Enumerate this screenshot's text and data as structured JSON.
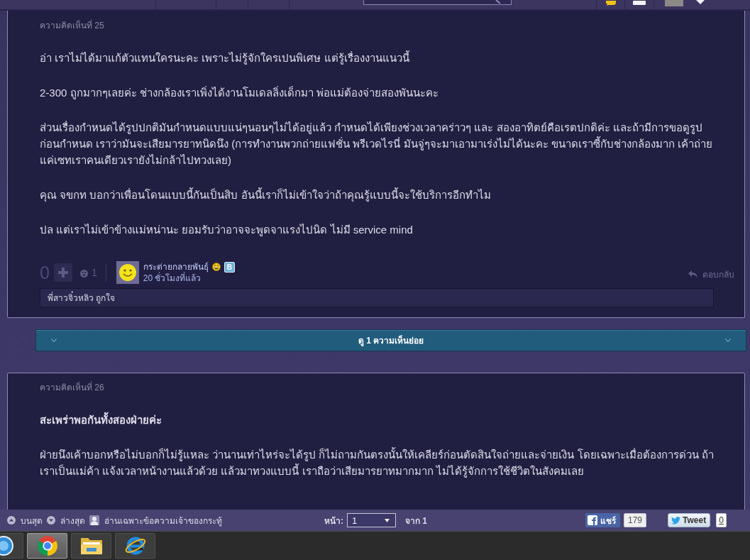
{
  "comments": [
    {
      "number_label": "ความคิดเห็นที่ 25",
      "paragraphs": [
        {
          "text": "อ่า เราไม่ได้มาแก้ตัวแทนใครนะคะ เพราะไม่รู้จักใครเปนพิเศษ แต่รู้เรื่องงานแนวนี้",
          "bold": false
        },
        {
          "text": "2-300 ถูกมากๆเลยค่ะ ช่างกล้องเราเพิ่งได้งานโมเดลลิ่งเด็กมา พ่อแม่ต้องจ่ายสองพันนะคะ",
          "bold": false
        },
        {
          "text": "ส่วนเรื่องกำหนดได้รูปปกติมันกำหนดแบบแน่ๆนอนๆไม่ได้อยู่แล้ว กำหนดได้เพียงช่วงเวลาคร่าวๆ และ สองอาทิตย์คือเรตปกติค่ะ และถ้ามีการขอดูรูปก่อนกำหนด เราว่ามันจะเสียมารยาทนิดนึง (การทำงานพวกถ่ายแฟชั่น พรีเวดไรนี่ มันจู่ๆจะมาเอามาเร่งไม่ได้นะคะ ขนาดเราซี้กับช่างกล้องมาก เค้าถ่ายแค่เซทเราคนเดียวเรายังไม่กล้าไปทวงเลย)",
          "bold": false
        },
        {
          "text": "คุณ จขกท บอกว่าเพื่อนโดนแบบนี้กันเป็นสิบ อันนี้เราก็ไม่เข้าใจว่าถ้าคุณรู้แบบนี้จะใช้บริการอีกทำไม",
          "bold": false
        },
        {
          "text": "ปล แต่เราไม่เข้าข้างแม่หน่านะ ยอมรับว่าอาจจะพูดจาแรงไปนิด ไม่มี service mind",
          "bold": false
        }
      ],
      "votes": "0",
      "emotion_count": "1",
      "author": {
        "name": "กระต่ายกลายพันธุ์",
        "badge": "B",
        "time": "20 ชั่วโมงที่แล้ว"
      },
      "reply_label": "ตอบกลับ",
      "reactions_note": "พี่สาวจิ๋วหลิว ถูกใจ",
      "replies_button": "ดู 1 ความเห็นย่อย"
    },
    {
      "number_label": "ความคิดเห็นที่ 26",
      "paragraphs": [
        {
          "text": "สะเพร่าพอกันทั้งสองฝ่ายค่ะ",
          "bold": true
        },
        {
          "text": "ฝ่ายนึงเค้าบอกหรือไม่บอกก็ไม่รู้แหละ ว่านานเท่าไหร่จะได้รูป ก็ไม่ถามกันตรงนั้นให้เคลียร์ก่อนตัดสินใจถ่ายและจ่ายเงิน โดยเฉพาะเมื่อต้องการด่วน ถ้าเราเป็นแม่ค้า แจ้งเวลาหน้างานแล้วด้วย แล้วมาทวงแบบนี้ เราถือว่าเสียมารยาทมากมาก ไม่ได้รู้จักการใช้ชีวิตในสังคมเลย",
          "bold": false
        }
      ]
    }
  ],
  "bottom_bar": {
    "links": [
      {
        "label": "บนสุด",
        "kind": "top"
      },
      {
        "label": "ล่างสุด",
        "kind": "bottom"
      },
      {
        "label": "อ่านเฉพาะข้อความเจ้าของกระทู้",
        "kind": "owner"
      }
    ],
    "page_label": "หน้า:",
    "page_value": "1",
    "page_total": "จาก 1",
    "share": {
      "label": "แชร์",
      "count": "179"
    },
    "tweet": {
      "label": "Tweet",
      "count": "0"
    }
  },
  "taskbar": {
    "apps": [
      {
        "kind": "music",
        "selected": false
      },
      {
        "kind": "browser",
        "selected": true
      },
      {
        "kind": "folder",
        "selected": false
      },
      {
        "kind": "webbrowser",
        "selected": false
      }
    ]
  }
}
